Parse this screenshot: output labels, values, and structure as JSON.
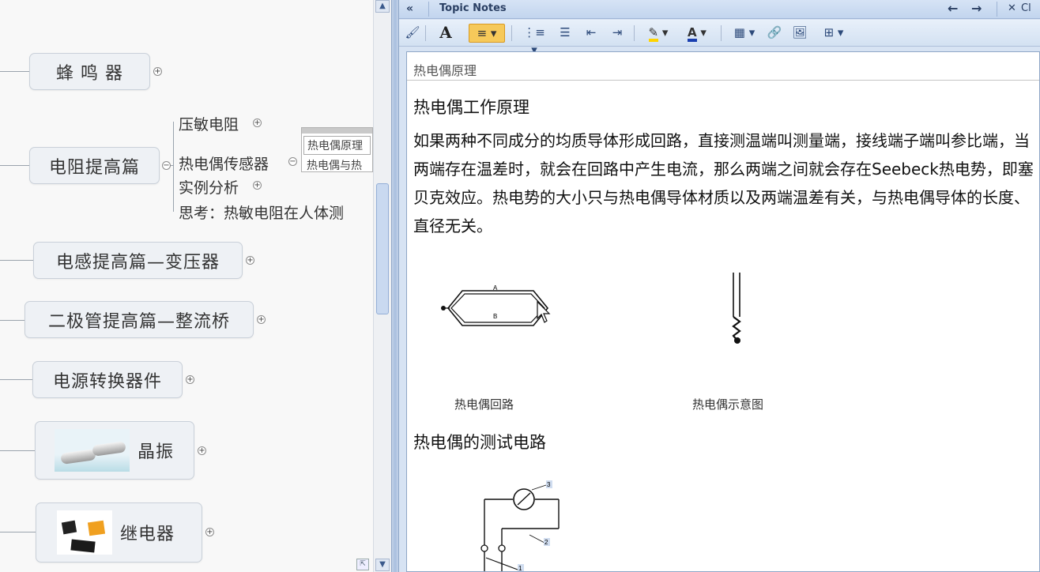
{
  "mindmap": {
    "topics": [
      {
        "label": "蜂 鸣 器"
      },
      {
        "label": "电阻提高篇"
      },
      {
        "label": "电感提高篇—变压器"
      },
      {
        "label": "二极管提高篇—整流桥"
      },
      {
        "label": "电源转换器件"
      },
      {
        "label": "晶振"
      },
      {
        "label": "继电器"
      }
    ],
    "subtopics": [
      {
        "label": "压敏电阻"
      },
      {
        "label": "热电偶传感器"
      },
      {
        "label": "实例分析"
      },
      {
        "label": "思考：热敏电阻在人体测"
      }
    ],
    "note_preview": {
      "line1": "热电偶原理",
      "line2": "热电偶与热"
    }
  },
  "notes_panel": {
    "title": "Topic Notes",
    "close_label": "Cl",
    "doc_title": "热电偶原理",
    "heading1": "热电偶工作原理",
    "paragraph": "如果两种不同成分的均质导体形成回路，直接测温端叫测量端，接线端子端叫参比端，当两端存在温差时，就会在回路中产生电流，那么两端之间就会存在Seebeck热电势，即塞贝克效应。热电势的大小只与热电偶导体材质以及两端温差有关，与热电偶导体的长度、直径无关。",
    "caption1": "热电偶回路",
    "caption2": "热电偶示意图",
    "heading2": "热电偶的测试电路",
    "fig_label_a": "A",
    "fig_label_b": "B",
    "circuit_labels": [
      "3",
      "2",
      "1"
    ]
  },
  "toolbar_icons": [
    "format-painter-icon",
    "font-icon",
    "align-left-icon",
    "numbered-list-icon",
    "bullet-list-icon",
    "decrease-indent-icon",
    "increase-indent-icon",
    "highlight-icon",
    "font-color-icon",
    "table-icon",
    "link-icon",
    "image-icon",
    "insert-field-icon"
  ],
  "colors": {
    "accent": "#c2d5ee",
    "align_active": "#f6c95a",
    "highlight": "#ffd400",
    "font_color": "#1a3fb0"
  }
}
